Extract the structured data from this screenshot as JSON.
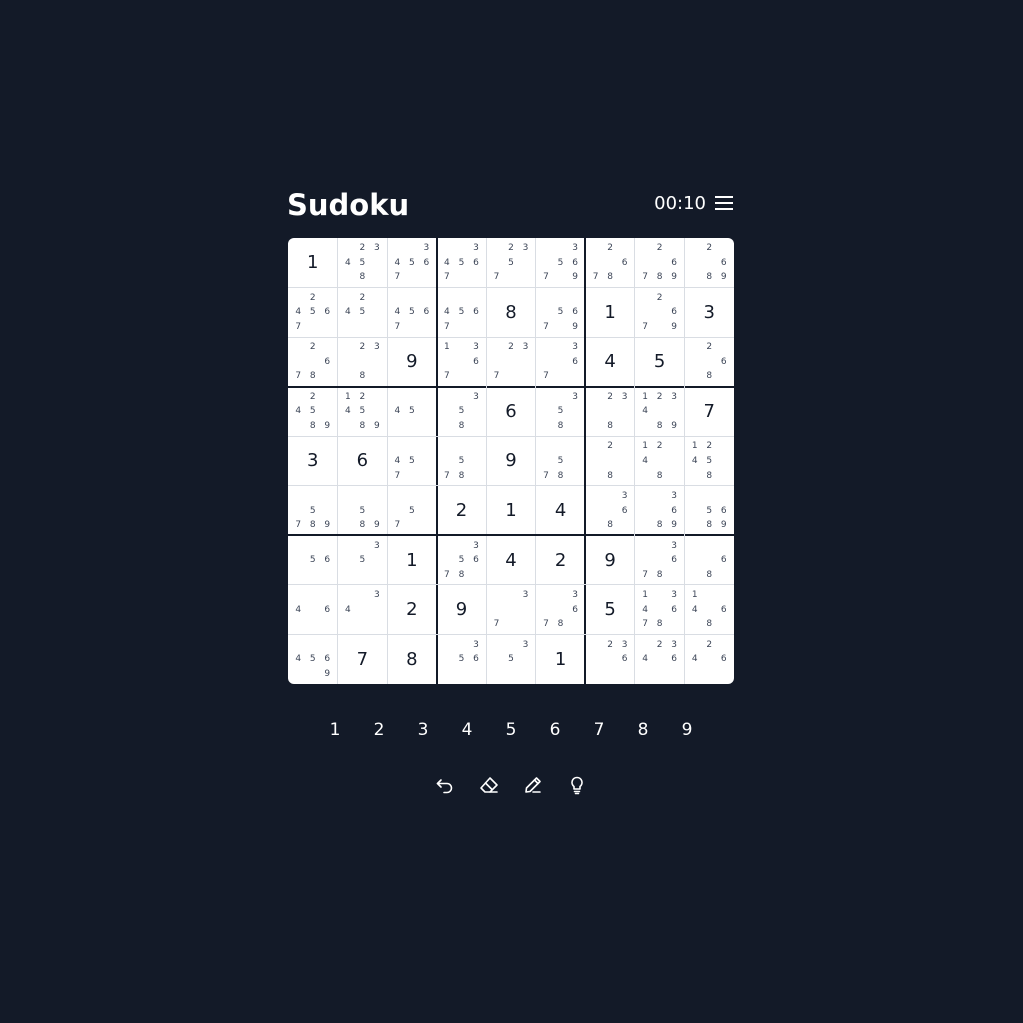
{
  "title": "Sudoku",
  "timer": "00:10",
  "icons": {
    "menu": "hamburger-menu-icon",
    "undo": "undo-icon",
    "erase": "eraser-icon",
    "notes": "pencil-icon",
    "hint": "lightbulb-icon"
  },
  "colors": {
    "background": "#131a28",
    "board": "#ffffff",
    "digit": "#131a28",
    "note": "#3b4456",
    "thin_line": "#d9dde3"
  },
  "board": {
    "rows": [
      [
        {
          "v": "1"
        },
        {
          "n": [
            2,
            3,
            4,
            5,
            8
          ]
        },
        {
          "n": [
            3,
            4,
            5,
            6,
            7
          ]
        },
        {
          "n": [
            3,
            4,
            5,
            6,
            7
          ]
        },
        {
          "n": [
            2,
            3,
            5,
            7
          ]
        },
        {
          "n": [
            3,
            5,
            6,
            7,
            9
          ]
        },
        {
          "n": [
            2,
            6,
            7,
            8
          ]
        },
        {
          "n": [
            2,
            6,
            7,
            8,
            9
          ]
        },
        {
          "n": [
            2,
            6,
            8,
            9
          ]
        }
      ],
      [
        {
          "n": [
            2,
            4,
            5,
            6,
            7
          ]
        },
        {
          "n": [
            2,
            4,
            5
          ]
        },
        {
          "n": [
            4,
            5,
            6,
            7
          ]
        },
        {
          "n": [
            4,
            5,
            6,
            7
          ]
        },
        {
          "v": "8"
        },
        {
          "n": [
            5,
            6,
            7,
            9
          ]
        },
        {
          "v": "1"
        },
        {
          "n": [
            2,
            6,
            7,
            9
          ]
        },
        {
          "v": "3"
        }
      ],
      [
        {
          "n": [
            2,
            6,
            7,
            8
          ]
        },
        {
          "n": [
            2,
            3,
            8
          ]
        },
        {
          "v": "9"
        },
        {
          "n": [
            1,
            3,
            6,
            7
          ]
        },
        {
          "n": [
            2,
            3,
            7
          ]
        },
        {
          "n": [
            3,
            6,
            7
          ]
        },
        {
          "v": "4"
        },
        {
          "v": "5"
        },
        {
          "n": [
            2,
            6,
            8
          ]
        }
      ],
      [
        {
          "n": [
            2,
            4,
            5,
            8,
            9
          ]
        },
        {
          "n": [
            1,
            2,
            4,
            5,
            8,
            9
          ]
        },
        {
          "n": [
            4,
            5
          ]
        },
        {
          "n": [
            3,
            5,
            8
          ]
        },
        {
          "v": "6"
        },
        {
          "n": [
            3,
            5,
            8
          ]
        },
        {
          "n": [
            2,
            3,
            8
          ]
        },
        {
          "n": [
            1,
            2,
            3,
            4,
            8,
            9
          ]
        },
        {
          "v": "7"
        }
      ],
      [
        {
          "v": "3"
        },
        {
          "v": "6"
        },
        {
          "n": [
            4,
            5,
            7
          ]
        },
        {
          "n": [
            5,
            7,
            8
          ]
        },
        {
          "v": "9"
        },
        {
          "n": [
            5,
            7,
            8
          ]
        },
        {
          "n": [
            2,
            8
          ]
        },
        {
          "n": [
            1,
            2,
            4,
            8
          ]
        },
        {
          "n": [
            1,
            2,
            4,
            5,
            8
          ]
        }
      ],
      [
        {
          "n": [
            5,
            7,
            8,
            9
          ]
        },
        {
          "n": [
            5,
            8,
            9
          ]
        },
        {
          "n": [
            5,
            7
          ]
        },
        {
          "v": "2"
        },
        {
          "v": "1"
        },
        {
          "v": "4"
        },
        {
          "n": [
            3,
            6,
            8
          ]
        },
        {
          "n": [
            3,
            6,
            8,
            9
          ]
        },
        {
          "n": [
            5,
            6,
            8,
            9
          ]
        }
      ],
      [
        {
          "n": [
            5,
            6
          ]
        },
        {
          "n": [
            3,
            5
          ]
        },
        {
          "v": "1"
        },
        {
          "n": [
            3,
            5,
            6,
            7,
            8
          ]
        },
        {
          "v": "4"
        },
        {
          "v": "2"
        },
        {
          "v": "9"
        },
        {
          "n": [
            3,
            6,
            7,
            8
          ]
        },
        {
          "n": [
            6,
            8
          ]
        }
      ],
      [
        {
          "n": [
            4,
            6
          ]
        },
        {
          "n": [
            3,
            4
          ]
        },
        {
          "v": "2"
        },
        {
          "v": "9"
        },
        {
          "n": [
            3,
            7
          ]
        },
        {
          "n": [
            3,
            6,
            7,
            8
          ]
        },
        {
          "v": "5"
        },
        {
          "n": [
            1,
            3,
            4,
            6,
            7,
            8
          ]
        },
        {
          "n": [
            1,
            4,
            6,
            8
          ]
        }
      ],
      [
        {
          "n": [
            4,
            5,
            6,
            9
          ]
        },
        {
          "v": "7"
        },
        {
          "v": "8"
        },
        {
          "n": [
            3,
            5,
            6
          ]
        },
        {
          "n": [
            3,
            5
          ]
        },
        {
          "v": "1"
        },
        {
          "n": [
            2,
            3,
            6
          ]
        },
        {
          "n": [
            2,
            3,
            4,
            6
          ]
        },
        {
          "n": [
            2,
            4,
            6
          ]
        }
      ]
    ]
  },
  "numpad": [
    "1",
    "2",
    "3",
    "4",
    "5",
    "6",
    "7",
    "8",
    "9"
  ]
}
